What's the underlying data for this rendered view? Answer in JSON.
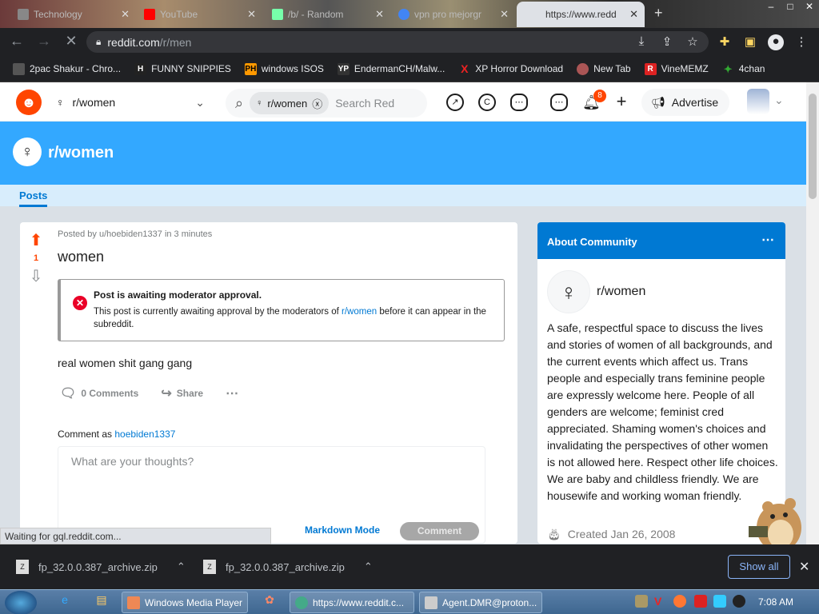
{
  "browser": {
    "tabs": [
      {
        "label": "Technology",
        "fav_color": "#888"
      },
      {
        "label": "YouTube",
        "fav_color": "#ff0000"
      },
      {
        "label": "/b/ - Random",
        "fav_color": "#7fa"
      },
      {
        "label": "vpn pro mejorgr",
        "fav_color": "#4285f4"
      },
      {
        "label": "https://www.redd",
        "fav_color": "#ff4500"
      }
    ],
    "url_host": "reddit.com",
    "url_path": "/r/men",
    "bookmarks": [
      {
        "label": "2pac Shakur - Chro...",
        "icon": "H",
        "color": "#444"
      },
      {
        "label": "FUNNY SNIPPIES",
        "icon": "H",
        "color": "#222"
      },
      {
        "label": "windows ISOS",
        "icon": "PH",
        "color": "#f90"
      },
      {
        "label": "EndermanCH/Malw...",
        "icon": "YP",
        "color": "#333"
      },
      {
        "label": "XP Horror Download",
        "icon": "X",
        "color": "#c00"
      },
      {
        "label": "New Tab",
        "icon": "●",
        "color": "#a55"
      },
      {
        "label": "VineMEMZ",
        "icon": "R",
        "color": "#d22"
      },
      {
        "label": "4chan",
        "icon": "✦",
        "color": "#3a3"
      }
    ]
  },
  "reddit": {
    "community_selector": "r/women",
    "search_chip": "r/women",
    "search_placeholder": "Search Red",
    "notification_count": "8",
    "advertise_label": "Advertise",
    "banner_title": "r/women",
    "tab_posts": "Posts"
  },
  "post": {
    "meta": "Posted by u/hoebiden1337 in 3 minutes",
    "vote_count": "1",
    "title": "women",
    "notice_title": "Post is awaiting moderator approval.",
    "notice_body_pre": "This post is currently awaiting approval by the moderators of ",
    "notice_link": "r/women",
    "notice_body_post": " before it can appear in the subreddit.",
    "body": "real women shit gang gang",
    "comments_label": "0 Comments",
    "share_label": "Share",
    "comment_as_label": "Comment as ",
    "comment_as_user": "hoebiden1337",
    "comment_placeholder": "What are your thoughts?",
    "markdown_mode": "Markdown Mode",
    "comment_button": "Comment"
  },
  "sidebar": {
    "header": "About Community",
    "name": "r/women",
    "description": "A safe, respectful space to discuss the lives and stories of women of all backgrounds, and the current events which affect us. Trans people and especially trans feminine people are expressly welcome here. People of all genders are welcome; feminist cred appreciated. Shaming women's choices and invalidating the perspectives of other women is not allowed here. Respect other life choices. We are baby and childless friendly. We are housewife and working woman friendly.",
    "created": "Created Jan 26, 2008"
  },
  "status_text": "Waiting for gql.reddit.com...",
  "downloads": [
    {
      "name": "fp_32.0.0.387_archive.zip"
    },
    {
      "name": "fp_32.0.0.387_archive.zip"
    }
  ],
  "show_all": "Show all",
  "taskbar": {
    "items": [
      {
        "label": "Windows Media Player",
        "color": "#e85"
      },
      {
        "label": "https://www.reddit.c...",
        "color": "#4a8"
      },
      {
        "label": "Agent.DMR@proton...",
        "color": "#ccc"
      }
    ],
    "clock": "7:08 AM"
  }
}
